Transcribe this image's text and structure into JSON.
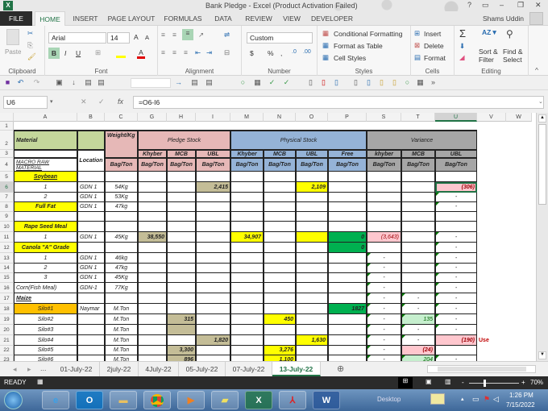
{
  "window": {
    "title": "Bank Pledge - Excel (Product Activation Failed)",
    "controls": {
      "help": "?",
      "ribbon_display": "▭",
      "minimize": "–",
      "restore": "❐",
      "close": "✕"
    }
  },
  "ribbon_tabs": [
    "FILE",
    "HOME",
    "INSERT",
    "PAGE LAYOUT",
    "FORMULAS",
    "DATA",
    "REVIEW",
    "VIEW",
    "DEVELOPER"
  ],
  "active_tab": "HOME",
  "user": {
    "name": "Shams Uddin"
  },
  "ribbon": {
    "clipboard": {
      "label": "Clipboard",
      "paste": "Paste"
    },
    "font": {
      "label": "Font",
      "font_name": "Arial",
      "font_size": "14",
      "bold": "B",
      "italic": "I",
      "underline": "U",
      "grow": "A",
      "shrink": "A"
    },
    "alignment": {
      "label": "Alignment"
    },
    "number": {
      "label": "Number",
      "format": "Custom",
      "currency": "$",
      "percent": "%",
      "comma": ","
    },
    "styles": {
      "label": "Styles",
      "conditional": "Conditional Formatting",
      "format_table": "Format as Table",
      "cell_styles": "Cell Styles"
    },
    "cells": {
      "label": "Cells",
      "insert": "Insert",
      "delete": "Delete",
      "format": "Format"
    },
    "editing": {
      "label": "Editing",
      "sum": "Σ",
      "sort": "Sort &",
      "sort2": "Filter",
      "find": "Find &",
      "find2": "Select"
    }
  },
  "formula_bar": {
    "name_box": "U6",
    "cancel": "✕",
    "enter": "✓",
    "fx": "fx",
    "formula": "=O6-I6"
  },
  "columns": [
    "A",
    "B",
    "C",
    "G",
    "H",
    "I",
    "M",
    "N",
    "O",
    "P",
    "S",
    "T",
    "U",
    "V",
    "W"
  ],
  "selected_column": "U",
  "rows": [
    "1",
    "2",
    "3",
    "4",
    "5",
    "6",
    "7",
    "8",
    "9",
    "10",
    "11",
    "12",
    "13",
    "14",
    "15",
    "16",
    "17",
    "18",
    "19",
    "20",
    "21",
    "22",
    "23"
  ],
  "selected_row": "6",
  "headers": {
    "material": "Material",
    "weight": "Weight/Kg",
    "pledge_stock": "Pledge Stock",
    "physical_stock": "Physical Stock",
    "variance": "Variance",
    "macro_raw": "MACRO RAW MATERIAL",
    "location": "Location",
    "bag_ton": "Bag/Ton",
    "khyber": "Khyber",
    "khyber_var": "khyber",
    "mcb": "MCB",
    "ubl": "UBL",
    "free": "Free"
  },
  "cells": {
    "A5": "Soybean",
    "A6": "1",
    "B6": "GDN 1",
    "C6": "54Kg",
    "I6": "2,415",
    "O6": "2,109",
    "U6": "(306)",
    "A7": "2",
    "B7": "GDN 1",
    "C7": "53Kg",
    "U7": "-",
    "A8": "Full Fat",
    "B8": "GDN 1",
    "C8": "47kg",
    "U8": "-",
    "A10": "Rape Seed Meal",
    "A11": "1",
    "B11": "GDN 1",
    "C11": "45Kg",
    "G11": "38,550",
    "M11": "34,907",
    "P11": "0",
    "S11": "(3,643)",
    "U11": "-",
    "A12": "Canola \"A\" Grade",
    "P12": "0",
    "U12": "-",
    "A13": "1",
    "B13": "GDN 1",
    "C13": "46kg",
    "S13": "-",
    "U13": "-",
    "A14": "2",
    "B14": "GDN 1",
    "C14": "47kg",
    "S14": "-",
    "U14": "-",
    "A15": "3",
    "B15": "GDN 1",
    "C15": "45Kg",
    "S15": "-",
    "U15": "-",
    "A16": "Corn(Fish Meal)",
    "B16": "GDN-1",
    "C16": "77Kg",
    "S16": "-",
    "U16": "-",
    "A17": "Maize",
    "S17": "-",
    "T17": "-",
    "U17": "-",
    "A18": "Silo#1",
    "B18": "Naymar",
    "C18": "M.Ton",
    "P18": "1827",
    "S18": "-",
    "T18": "-",
    "U18": "-",
    "A19": "Silo#2",
    "C19": "M.Ton",
    "H19": "315",
    "N19": "450",
    "S19": "-",
    "T19": "135",
    "U19": "-",
    "A20": "Silo#3",
    "C20": "M.Ton",
    "S20": "-",
    "T20": "-",
    "U20": "-",
    "A21": "Silo#4",
    "C21": "M.Ton",
    "I21": "1,820",
    "O21": "1,630",
    "S21": "-",
    "T21": "-",
    "U21": "(190)",
    "V21": "Use",
    "A22": "Silo#5",
    "C22": "M.Ton",
    "H22": "3,300",
    "N22": "3,276",
    "S22": "-",
    "T22": "(24)",
    "A23": "Silo#6",
    "C23": "M.Ton",
    "H23": "896",
    "N23": "1,100",
    "S23": "-",
    "T23": "204",
    "U23": "-"
  },
  "sheet_tabs": [
    "01-July-22",
    "2july-22",
    "4July-22",
    "05-July-22",
    "07-July-22",
    "13-July-22"
  ],
  "active_sheet": "13-July-22",
  "sheet_nav": {
    "prev": "◂",
    "next": "▸",
    "more": "...",
    "add": "⊕"
  },
  "status": {
    "ready": "READY",
    "zoom": "70%",
    "zoom_minus": "-",
    "zoom_plus": "+"
  },
  "taskbar": {
    "apps": [
      "IE",
      "Outlook",
      "Explorer",
      "Chrome",
      "Media",
      "Sticky",
      "Excel",
      "Acrobat",
      "Word"
    ],
    "desktop": "Desktop",
    "time": "1:26 PM",
    "date": "7/15/2022"
  }
}
